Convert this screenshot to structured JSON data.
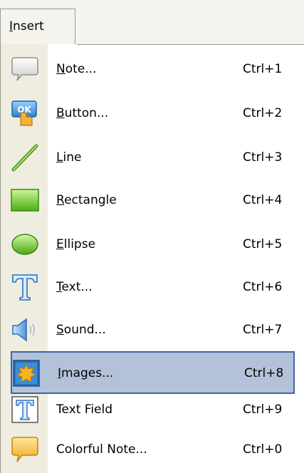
{
  "menu": {
    "title_mnemonic": "I",
    "title_rest": "nsert"
  },
  "items": [
    {
      "mnemonic": "N",
      "rest": "ote...",
      "shortcut": "Ctrl+1",
      "icon": "note-icon"
    },
    {
      "mnemonic": "B",
      "rest": "utton...",
      "shortcut": "Ctrl+2",
      "icon": "button-icon"
    },
    {
      "mnemonic": "L",
      "rest": "ine",
      "shortcut": "Ctrl+3",
      "icon": "line-icon"
    },
    {
      "mnemonic": "R",
      "rest": "ectangle",
      "shortcut": "Ctrl+4",
      "icon": "rectangle-icon"
    },
    {
      "mnemonic": "E",
      "rest": "llipse",
      "shortcut": "Ctrl+5",
      "icon": "ellipse-icon"
    },
    {
      "mnemonic": "T",
      "rest": "ext...",
      "shortcut": "Ctrl+6",
      "icon": "text-icon"
    },
    {
      "mnemonic": "S",
      "rest": "ound...",
      "shortcut": "Ctrl+7",
      "icon": "sound-icon"
    },
    {
      "mnemonic": "I",
      "rest": "mages...",
      "shortcut": "Ctrl+8",
      "icon": "image-icon",
      "selected": true
    },
    {
      "mnemonic": "",
      "rest": "Text Field",
      "shortcut": "Ctrl+9",
      "icon": "text-field-icon"
    },
    {
      "mnemonic": "",
      "rest": "Colorful Note...",
      "shortcut": "Ctrl+0",
      "icon": "colorful-note-icon"
    }
  ],
  "colors": {
    "selection_fill": "#b4c2d9",
    "selection_border": "#3e64a6",
    "gutter": "#efede0",
    "menubar": "#f4f3ee"
  }
}
